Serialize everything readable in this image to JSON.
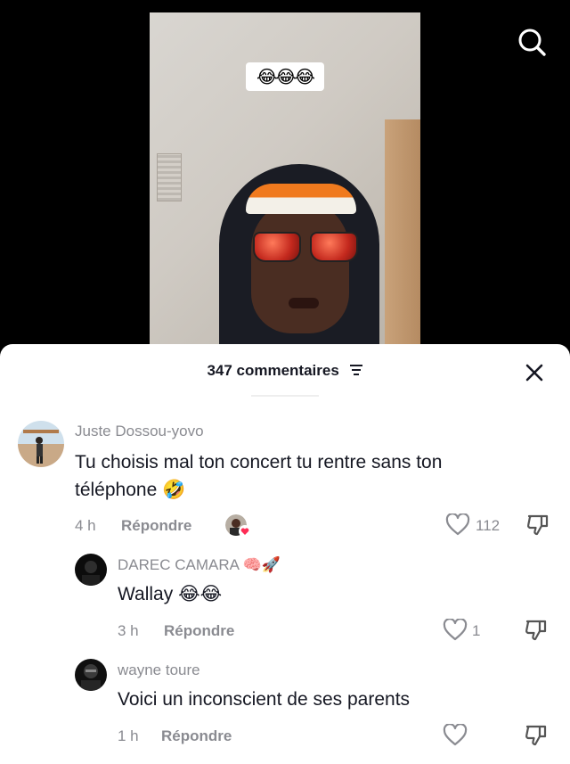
{
  "video": {
    "overlay_text": "😂😂😂"
  },
  "header": {
    "comment_count_label": "347 commentaires"
  },
  "comments": [
    {
      "username": "Juste Dossou-yovo",
      "text_line1": "Tu choisis mal ton concert tu rentre sans ton",
      "text_line2": "téléphone 🤣",
      "time": "4 h",
      "reply_label": "Répondre",
      "likes": "112"
    },
    {
      "username": "DAREC CAMARA 🧠🚀",
      "text": "Wallay 😂😂",
      "time": "3 h",
      "reply_label": "Répondre",
      "likes": "1"
    },
    {
      "username": "wayne toure",
      "text": "Voici un inconscient de ses parents",
      "time": "1 h",
      "reply_label": "Répondre",
      "likes": ""
    }
  ],
  "icons": {
    "search": "search-icon",
    "close": "close-icon",
    "filter": "filter-icon",
    "heart": "heart-icon",
    "dislike": "dislike-icon"
  }
}
